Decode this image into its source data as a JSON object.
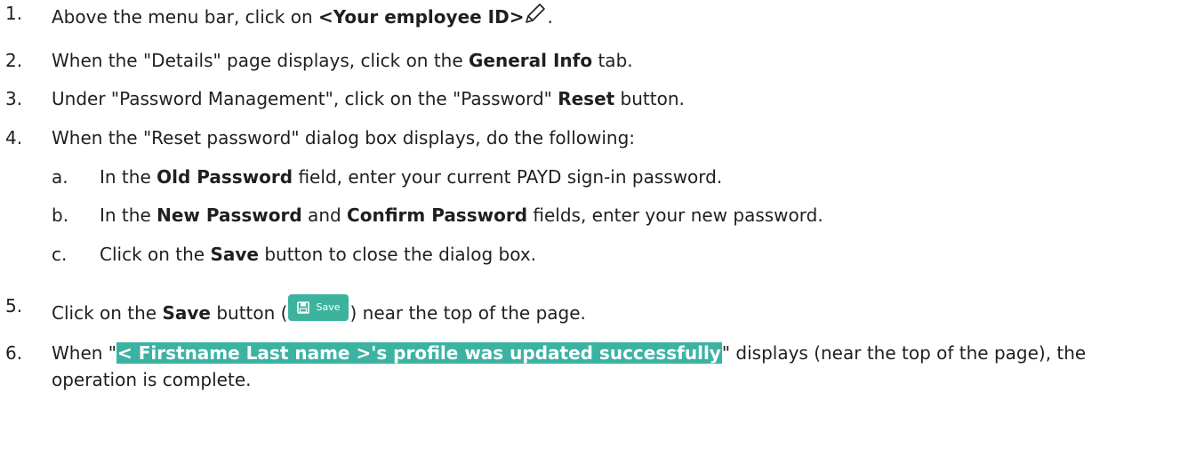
{
  "steps": [
    {
      "num": "1.",
      "pre": "Above the menu bar, click on ",
      "bold": "<Your employee ID>",
      "post": "."
    },
    {
      "num": "2.",
      "pre": "When the \"Details\" page displays, click on the ",
      "bold": "General Info",
      "post": " tab."
    },
    {
      "num": "3.",
      "pre": "Under \"Password Management\", click on the \"Password\" ",
      "bold": "Reset",
      "post": " button."
    },
    {
      "num": "4.",
      "text": "When the \"Reset password\" dialog box displays, do the following:"
    },
    {
      "num": "5.",
      "pre": "Click on the ",
      "bold": "Save",
      "mid": " button (",
      "post": ") near the top of the page."
    },
    {
      "num": "6.",
      "pre": "When \"",
      "highlight": "< Firstname Last name >'s profile was updated successfully",
      "post": "\" displays (near the top of the page), the",
      "line2": "operation is complete."
    }
  ],
  "substeps": [
    {
      "num": "a.",
      "pre": "In the ",
      "bold": "Old Password",
      "post": " field, enter your current PAYD sign-in password."
    },
    {
      "num": "b.",
      "pre": "In the ",
      "bold": "New Password",
      "mid": " and ",
      "bold2": "Confirm Password",
      "post": " fields, enter your new password."
    },
    {
      "num": "c.",
      "pre": "Click on the ",
      "bold": "Save",
      "post": " button to close the dialog box."
    }
  ],
  "save_button_label": "Save",
  "icons": {
    "edit": "pencil-icon",
    "save": "floppy-disk-icon"
  },
  "colors": {
    "highlight": "#3cb3a2",
    "save_button": "#3db39e"
  }
}
